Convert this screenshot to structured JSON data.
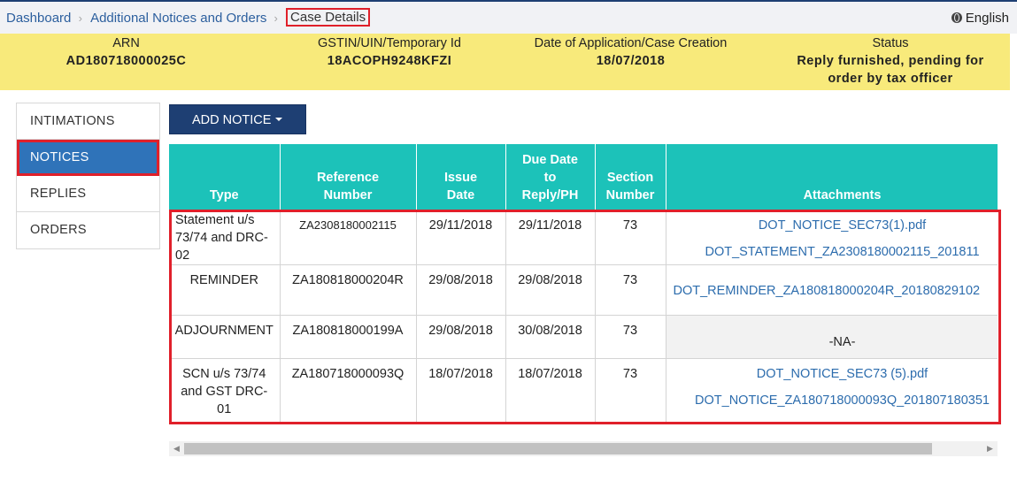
{
  "breadcrumb": {
    "items": [
      "Dashboard",
      "Additional Notices and Orders"
    ],
    "current": "Case Details"
  },
  "language": {
    "icon": "globe-icon",
    "label": "English"
  },
  "case_info": {
    "arn": {
      "label": "ARN",
      "value": "AD180718000025C"
    },
    "gstin": {
      "label": "GSTIN/UIN/Temporary Id",
      "value": "18ACOPH9248KFZI"
    },
    "date": {
      "label": "Date of Application/Case Creation",
      "value": "18/07/2018"
    },
    "status": {
      "label": "Status",
      "value_line1": "Reply furnished, pending for",
      "value_line2": "order by tax officer"
    }
  },
  "sidebar": {
    "items": [
      {
        "label": "INTIMATIONS",
        "active": false
      },
      {
        "label": "NOTICES",
        "active": true
      },
      {
        "label": "REPLIES",
        "active": false
      },
      {
        "label": "ORDERS",
        "active": false
      }
    ]
  },
  "add_notice_button": {
    "label": "ADD NOTICE",
    "icon": "caret-down-icon"
  },
  "table": {
    "headers": {
      "type": "Type",
      "reference_line1": "Reference",
      "reference_line2": "Number",
      "issue_line1": "Issue",
      "issue_line2": "Date",
      "due_line1": "Due Date",
      "due_line2": "to",
      "due_line3": "Reply/PH",
      "section_line1": "Section",
      "section_line2": "Number",
      "attachments": "Attachments"
    },
    "rows": [
      {
        "type_line1": "Statement u/s",
        "type_line2": "73/74 and DRC-",
        "type_line3": "02",
        "reference": "ZA2308180002115",
        "issue_date": "29/11/2018",
        "due_date": "29/11/2018",
        "section": "73",
        "attachments": [
          "DOT_NOTICE_SEC73(1).pdf",
          "DOT_STATEMENT_ZA2308180002115_201811"
        ]
      },
      {
        "type": "REMINDER",
        "reference": "ZA180818000204R",
        "issue_date": "29/08/2018",
        "due_date": "29/08/2018",
        "section": "73",
        "attachments": [
          "DOT_REMINDER_ZA180818000204R_20180829102"
        ]
      },
      {
        "type": "ADJOURNMENT",
        "reference": "ZA180818000199A",
        "issue_date": "29/08/2018",
        "due_date": "30/08/2018",
        "section": "73",
        "attachments_text": "-NA-"
      },
      {
        "type_line1": "SCN u/s 73/74",
        "type_line2": "and GST DRC-",
        "type_line3": "01",
        "reference": "ZA180718000093Q",
        "issue_date": "18/07/2018",
        "due_date": "18/07/2018",
        "section": "73",
        "attachments": [
          "DOT_NOTICE_SEC73 (5).pdf",
          "DOT_NOTICE_ZA180718000093Q_201807180351"
        ]
      }
    ]
  },
  "scrollbar": {
    "left_icon": "arrow-left-icon",
    "right_icon": "arrow-right-icon"
  },
  "colors": {
    "header_band": "#f8ea7b",
    "table_header": "#1cc2b9",
    "nav_active": "#2f73b9",
    "button": "#1e3f73",
    "highlight": "#e0202a",
    "link": "#2c6cad"
  }
}
